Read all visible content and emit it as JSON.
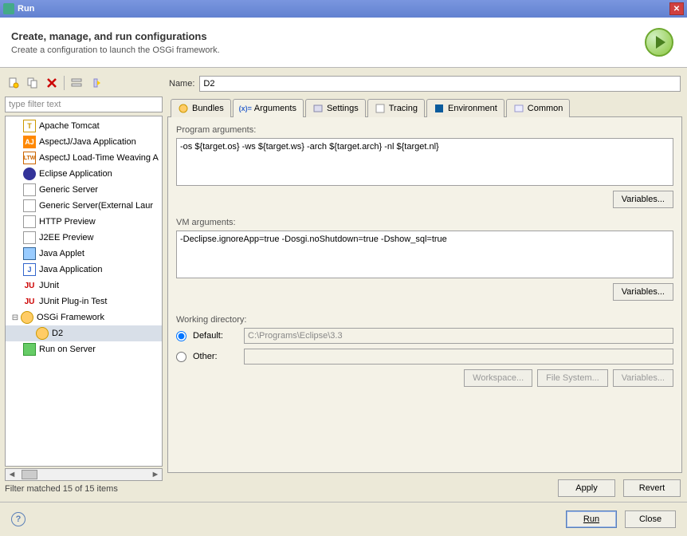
{
  "title": "Run",
  "header": {
    "title": "Create, manage, and run configurations",
    "subtitle": "Create a configuration to launch the OSGi framework."
  },
  "filter": {
    "placeholder": "type filter text"
  },
  "tree": {
    "items": [
      {
        "label": "Apache Tomcat"
      },
      {
        "label": "AspectJ/Java Application"
      },
      {
        "label": "AspectJ Load-Time Weaving A"
      },
      {
        "label": "Eclipse Application"
      },
      {
        "label": "Generic Server"
      },
      {
        "label": "Generic Server(External Laur"
      },
      {
        "label": "HTTP Preview"
      },
      {
        "label": "J2EE Preview"
      },
      {
        "label": "Java Applet"
      },
      {
        "label": "Java Application"
      },
      {
        "label": "JUnit"
      },
      {
        "label": "JUnit Plug-in Test"
      },
      {
        "label": "OSGi Framework",
        "expanded": true,
        "children": [
          {
            "label": "D2"
          }
        ]
      },
      {
        "label": "Run on Server"
      }
    ]
  },
  "filter_status": "Filter matched 15 of 15 items",
  "name_label": "Name:",
  "name_value": "D2",
  "tabs": [
    {
      "label": "Bundles"
    },
    {
      "label": "Arguments",
      "active": true
    },
    {
      "label": "Settings"
    },
    {
      "label": "Tracing"
    },
    {
      "label": "Environment"
    },
    {
      "label": "Common"
    }
  ],
  "program_args": {
    "label": "Program arguments:",
    "value": "-os ${target.os} -ws ${target.ws} -arch ${target.arch} -nl ${target.nl}",
    "variables_btn": "Variables..."
  },
  "vm_args": {
    "label": "VM arguments:",
    "value": "-Declipse.ignoreApp=true -Dosgi.noShutdown=true -Dshow_sql=true",
    "variables_btn": "Variables..."
  },
  "working_dir": {
    "label": "Working directory:",
    "default_label": "Default:",
    "default_value": "C:\\Programs\\Eclipse\\3.3",
    "other_label": "Other:",
    "workspace_btn": "Workspace...",
    "filesystem_btn": "File System...",
    "variables_btn": "Variables..."
  },
  "apply_btn": "Apply",
  "revert_btn": "Revert",
  "run_btn": "Run",
  "close_btn": "Close"
}
